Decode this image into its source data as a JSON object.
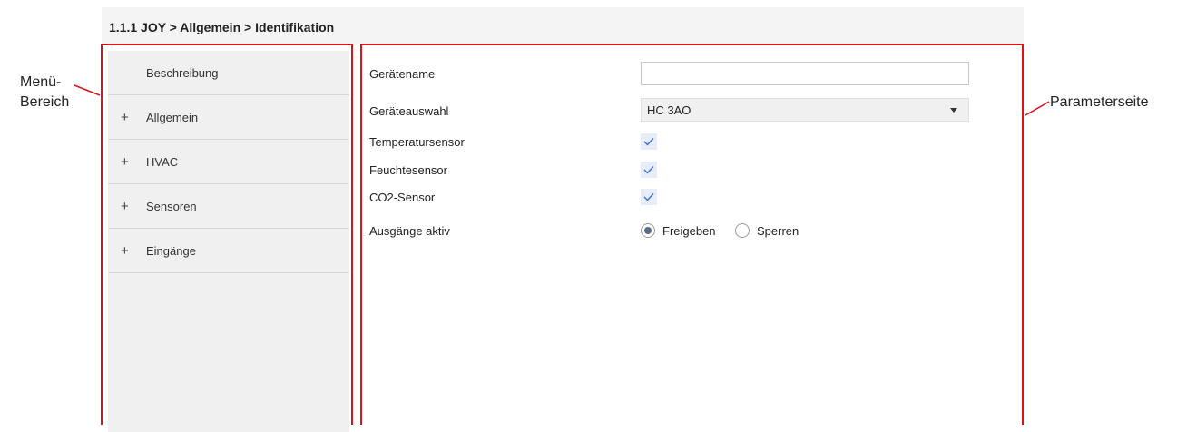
{
  "header": {
    "breadcrumb": "1.1.1 JOY > Allgemein > Identifikation"
  },
  "menu": {
    "items": [
      {
        "label": "Beschreibung",
        "expandable": false
      },
      {
        "label": "Allgemein",
        "expandable": true
      },
      {
        "label": "HVAC",
        "expandable": true
      },
      {
        "label": "Sensoren",
        "expandable": true
      },
      {
        "label": "Eingänge",
        "expandable": true
      }
    ],
    "plus_glyph": "+"
  },
  "params": {
    "geraetename": {
      "label": "Gerätename",
      "value": ""
    },
    "geraeteauswahl": {
      "label": "Geräteauswahl",
      "value": "HC 3AO"
    },
    "temperatursensor": {
      "label": "Temperatursensor",
      "checked": true
    },
    "feuchtesensor": {
      "label": "Feuchtesensor",
      "checked": true
    },
    "co2sensor": {
      "label": "CO2-Sensor",
      "checked": true
    },
    "ausgaenge": {
      "label": "Ausgänge aktiv",
      "options": [
        "Freigeben",
        "Sperren"
      ],
      "selected": "Freigeben"
    }
  },
  "callouts": {
    "menu_line1": "Menü-",
    "menu_line2": "Bereich",
    "params": "Parameterseite"
  },
  "colors": {
    "frame": "#d9141b",
    "check_bg": "#e6edf8",
    "check_mark": "#3b6fd4"
  },
  "icons": {
    "check": "check-icon",
    "dropdown": "dropdown-arrow-icon",
    "expand": "plus-icon"
  }
}
